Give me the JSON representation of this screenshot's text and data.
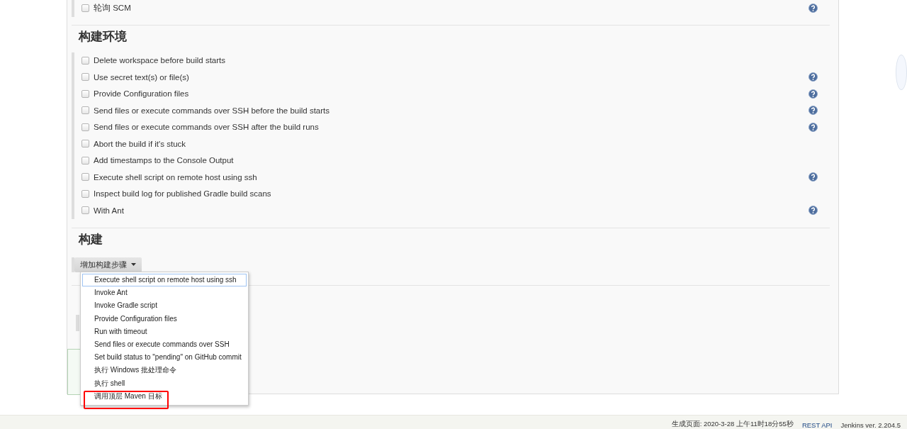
{
  "sections": [
    {
      "rows": [
        {
          "label": "轮询 SCM",
          "checked": false,
          "help": true
        }
      ]
    },
    {
      "heading": "构建环境",
      "rows": [
        {
          "label": "Delete workspace before build starts",
          "checked": false,
          "help": false
        },
        {
          "label": "Use secret text(s) or file(s)",
          "checked": false,
          "help": true
        },
        {
          "label": "Provide Configuration files",
          "checked": false,
          "help": true
        },
        {
          "label": "Send files or execute commands over SSH before the build starts",
          "checked": false,
          "help": true
        },
        {
          "label": "Send files or execute commands over SSH after the build runs",
          "checked": false,
          "help": true
        },
        {
          "label": "Abort the build if it's stuck",
          "checked": false,
          "help": false
        },
        {
          "label": "Add timestamps to the Console Output",
          "checked": false,
          "help": false
        },
        {
          "label": "Execute shell script on remote host using ssh",
          "checked": false,
          "help": true
        },
        {
          "label": "Inspect build log for published Gradle build scans",
          "checked": false,
          "help": false
        },
        {
          "label": "With Ant",
          "checked": false,
          "help": true
        }
      ]
    }
  ],
  "build": {
    "heading": "构建",
    "button": "增加构建步骤",
    "menu": [
      {
        "label": "Execute shell script on remote host using ssh",
        "selected": true
      },
      {
        "label": "Invoke Ant",
        "selected": false
      },
      {
        "label": "Invoke Gradle script",
        "selected": false
      },
      {
        "label": "Provide Configuration files",
        "selected": false
      },
      {
        "label": "Run with timeout",
        "selected": false
      },
      {
        "label": "Send files or execute commands over SSH",
        "selected": false
      },
      {
        "label": "Set build status to \"pending\" on GitHub commit",
        "selected": false
      },
      {
        "label": "执行 Windows 批处理命令",
        "selected": false
      },
      {
        "label": "执行 shell",
        "selected": false
      },
      {
        "label": "调用顶层 Maven 目标",
        "selected": false
      }
    ]
  },
  "footer": {
    "generated": "生成页面: 2020-3-28 上午11时18分55秒",
    "rest_api": "REST API",
    "version": "Jenkins ver. 2.204.5"
  }
}
